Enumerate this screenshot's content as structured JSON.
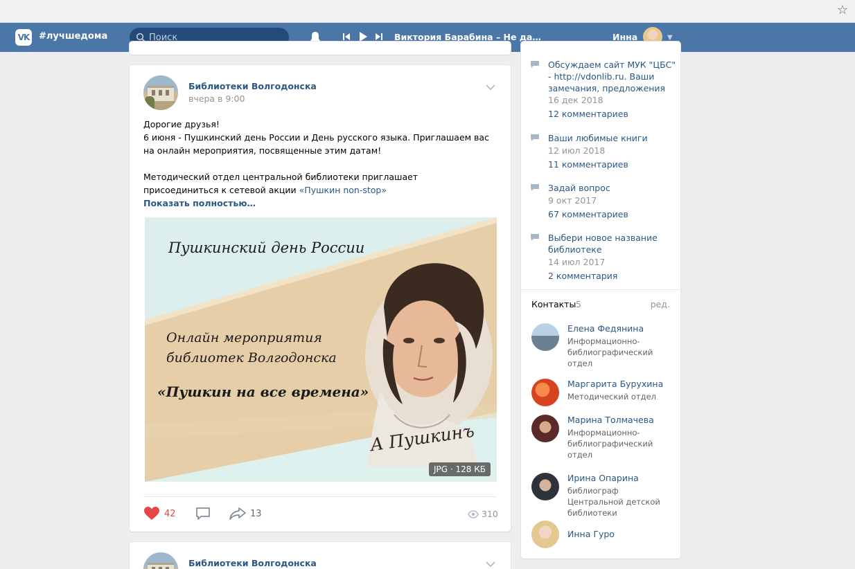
{
  "header": {
    "hashtag": "#лучшедома",
    "search_placeholder": "Поиск",
    "track": "Виктория Барабина – Не дай мне ...",
    "user_name": "Инна"
  },
  "post": {
    "author": "Библиотеки Волгодонска",
    "time": "вчера в 9:00",
    "line1": "Дорогие друзья!",
    "line2": "6 июня - Пушкинский день России и День русского языка. Приглашаем вас на онлайн мероприятия, посвященные этим датам!",
    "line3": "Методический отдел центральной библиотеки приглашает присоединиться к сетевой акции ",
    "link_text": "«Пушкин non-stop»",
    "show_more": "Показать полностью…",
    "image": {
      "title1": "Пушкинский день России",
      "title2a": "Онлайн мероприятия",
      "title2b": "библиотек Волгодонска",
      "title3": "«Пушкин на все времена»",
      "signature": "А Пушкинъ",
      "badge": "JPG · 128 КБ"
    },
    "likes": "42",
    "shares": "13",
    "views": "310"
  },
  "next_post": {
    "author": "Библиотеки Волгодонска"
  },
  "sidebar": {
    "topics": [
      {
        "title": "Обсуждаем сайт МУК \"ЦБС\" - http://vdonlib.ru. Ваши замечания, предложения",
        "date": "16 дек 2018",
        "comments": "12 комментариев"
      },
      {
        "title": "Ваши любимые книги",
        "date": "12 июл 2018",
        "comments": "11 комментариев"
      },
      {
        "title": "Задай вопрос",
        "date": "9 окт 2017",
        "comments": "67 комментариев"
      },
      {
        "title": "Выбери новое название библиотеке",
        "date": "14 июл 2017",
        "comments": "2 комментария"
      }
    ],
    "contacts_label": "Контакты",
    "contacts_count": "5",
    "contacts_edit": "ред.",
    "contacts": [
      {
        "name": "Елена Федянина",
        "role": "Информационно-библиографический отдел",
        "color": "#8fa9c4"
      },
      {
        "name": "Маргарита Бурухина",
        "role": "Методический отдел",
        "color": "#e0552c"
      },
      {
        "name": "Марина Толмачева",
        "role": "Информационно-библиографический отдел",
        "color": "#7a3b3b"
      },
      {
        "name": "Ирина Опарина",
        "role": "библиограф Центральной детской библиотеки",
        "color": "#3e4652"
      },
      {
        "name": "Инна Гуро",
        "role": "",
        "color": "#d9c39c"
      }
    ]
  }
}
